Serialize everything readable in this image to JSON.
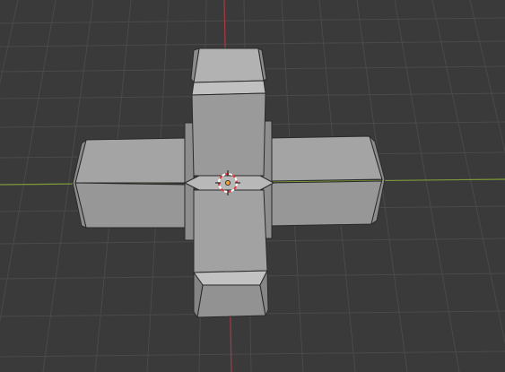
{
  "viewport": {
    "name": "3D Viewport",
    "background": "#3a3a3a",
    "grid_color": "#4b4b4b",
    "x_axis_color": "#7d9a3a",
    "y_axis_color": "#a63a45"
  },
  "object": {
    "shape": "cross-shaped-mesh",
    "face_color": "#9e9e9e",
    "shadow_face_color": "#8a8a8a",
    "light_face_color": "#b4b4b4",
    "edge_color": "#2a2a2a"
  },
  "cursor": {
    "icon": "3d-cursor-icon",
    "ring_color_a": "#e03a3a",
    "ring_color_b": "#ffffff"
  },
  "origin": {
    "icon": "object-origin-icon",
    "color": "#f0a030"
  }
}
